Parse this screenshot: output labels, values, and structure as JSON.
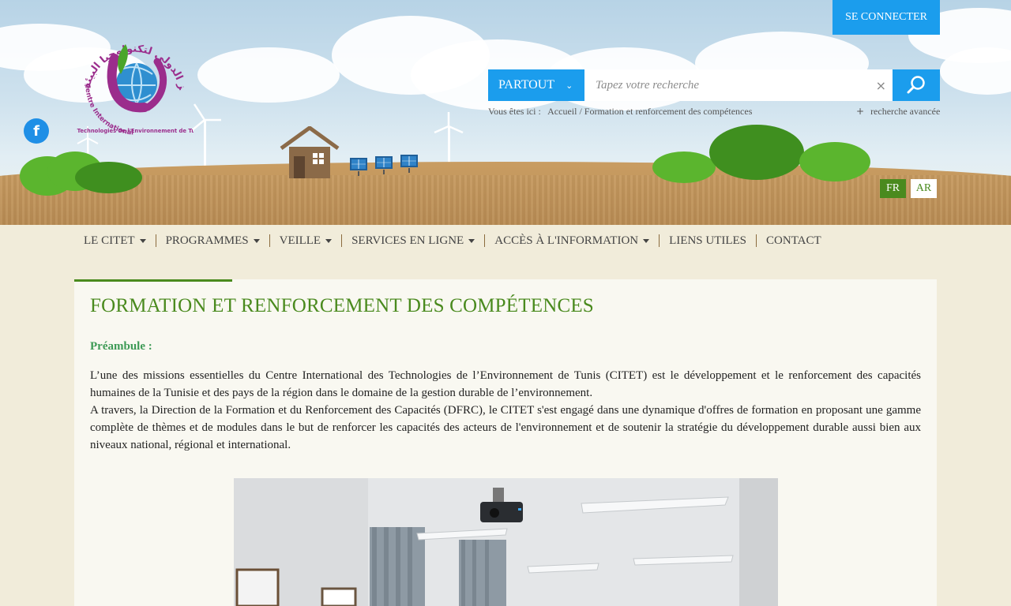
{
  "header": {
    "connect_label": "SE CONNECTER",
    "facebook_glyph": "f",
    "logo_arabic": "المركز الدولي لتكنولوجيا البيئة",
    "logo_fr_line1": "Centre International",
    "logo_fr_line2": "des Technologies de l'Environnement de Tunis"
  },
  "search": {
    "scope_label": "PARTOUT",
    "placeholder": "Tapez votre recherche",
    "clear_glyph": "×",
    "advanced_label": "recherche avancée",
    "advanced_plus": "+"
  },
  "breadcrumb": {
    "prefix": "Vous êtes ici :",
    "home": "Accueil",
    "separator": "/",
    "current": "Formation et renforcement des compétences"
  },
  "languages": [
    {
      "label": "FR",
      "active": true
    },
    {
      "label": "AR",
      "active": false
    }
  ],
  "nav": {
    "items": [
      {
        "label": "LE CITET",
        "dropdown": true
      },
      {
        "label": "PROGRAMMES",
        "dropdown": true
      },
      {
        "label": "VEILLE",
        "dropdown": true
      },
      {
        "label": "SERVICES EN LIGNE",
        "dropdown": true
      },
      {
        "label": "ACCÈS À L'INFORMATION",
        "dropdown": true
      },
      {
        "label": "LIENS UTILES",
        "dropdown": false
      },
      {
        "label": "CONTACT",
        "dropdown": false
      }
    ]
  },
  "content": {
    "title": "FORMATION ET RENFORCEMENT DES COMPÉTENCES",
    "subtitle": "Préambule :",
    "paragraph1": "L’une des missions essentielles du Centre International des Technologies de l’Environnement de Tunis (CITET) est le développement et le renforcement des capacités humaines de la Tunisie et des pays de la région dans le domaine de la gestion durable de l’environnement.",
    "paragraph2": "A travers, la Direction de la Formation et du Renforcement des Capacités (DFRC), le CITET s'est engagé dans une dynamique d'offres de formation en proposant une gamme complète de thèmes et de modules dans le but de renforcer les capacités des acteurs de l'environnement et de soutenir la stratégie du développement durable aussi bien aux niveaux national, régional et international."
  },
  "colors": {
    "accent_blue": "#1b9ded",
    "brand_green": "#4a8a1e",
    "subtitle_green": "#3d9a55",
    "ground": "#f1ecda"
  }
}
